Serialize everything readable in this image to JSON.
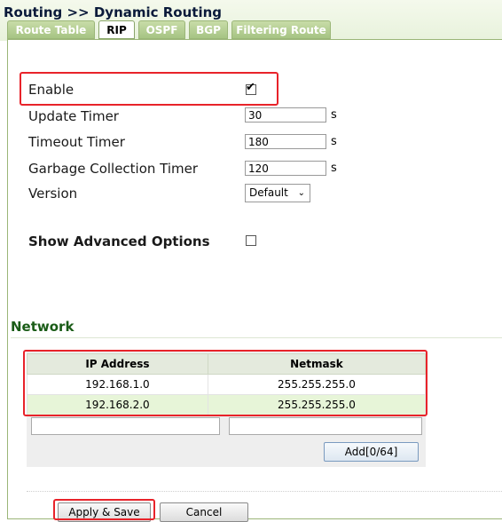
{
  "breadcrumb": "Routing >> Dynamic Routing",
  "tabs": [
    {
      "label": "Route Table",
      "active": false
    },
    {
      "label": "RIP",
      "active": true
    },
    {
      "label": "OSPF",
      "active": false
    },
    {
      "label": "BGP",
      "active": false
    },
    {
      "label": "Filtering Route",
      "active": false
    }
  ],
  "rip": {
    "enable_label": "Enable",
    "enable_checked": true,
    "update_timer_label": "Update Timer",
    "update_timer_value": "30",
    "timeout_timer_label": "Timeout Timer",
    "timeout_timer_value": "180",
    "garbage_timer_label": "Garbage Collection Timer",
    "garbage_timer_value": "120",
    "unit": "s",
    "version_label": "Version",
    "version_value": "Default",
    "advanced_label": "Show Advanced Options",
    "advanced_checked": false
  },
  "network": {
    "title": "Network",
    "columns": [
      "IP Address",
      "Netmask"
    ],
    "rows": [
      {
        "ip": "192.168.1.0",
        "mask": "255.255.255.0"
      },
      {
        "ip": "192.168.2.0",
        "mask": "255.255.255.0"
      }
    ],
    "add_label": "Add[0/64]"
  },
  "actions": {
    "apply_label": "Apply & Save",
    "cancel_label": "Cancel"
  },
  "colors": {
    "highlight": "#e8232a",
    "tab_inactive": "#a6c483",
    "section_title": "#1a5c17",
    "row_alt": "#e7f5d8"
  }
}
